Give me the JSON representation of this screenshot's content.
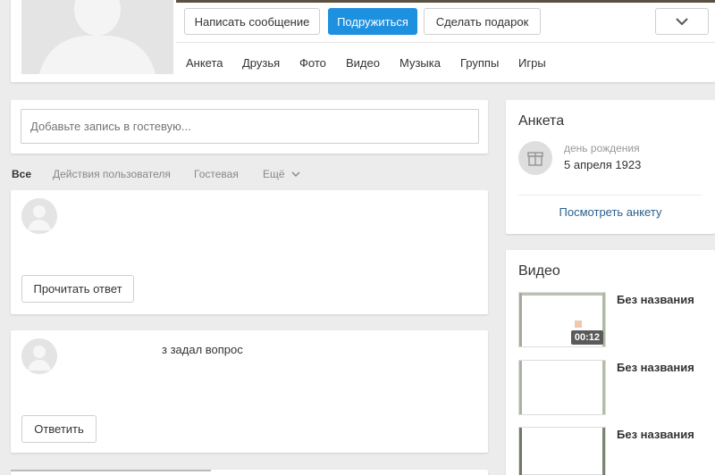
{
  "header": {
    "buttons": {
      "write_message": "Написать сообщение",
      "add_friend": "Подружиться",
      "make_gift": "Сделать подарок"
    },
    "nav": [
      "Анкета",
      "Друзья",
      "Фото",
      "Видео",
      "Музыка",
      "Группы",
      "Игры"
    ]
  },
  "guestbook": {
    "placeholder": "Добавьте запись в гостевую..."
  },
  "feed_tabs": {
    "all": "Все",
    "user_actions": "Действия пользователя",
    "guestbook": "Гостевая",
    "more": "Ещё"
  },
  "feed": [
    {
      "text": "",
      "action": "Прочитать ответ"
    },
    {
      "text": "з задал вопрос",
      "action": "Ответить"
    }
  ],
  "profile_card": {
    "title": "Анкета",
    "birthday_label": "день рождения",
    "birthday_value": "5 апреля 1923",
    "link": "Посмотреть анкету"
  },
  "videos": {
    "title": "Видео",
    "items": [
      {
        "title": "Без названия",
        "duration": "00:12"
      },
      {
        "title": "Без названия",
        "duration": ""
      },
      {
        "title": "Без названия",
        "duration": ""
      }
    ]
  },
  "colors": {
    "accent": "#1e90e0",
    "link": "#2a5f8f",
    "background": "#ececec"
  }
}
